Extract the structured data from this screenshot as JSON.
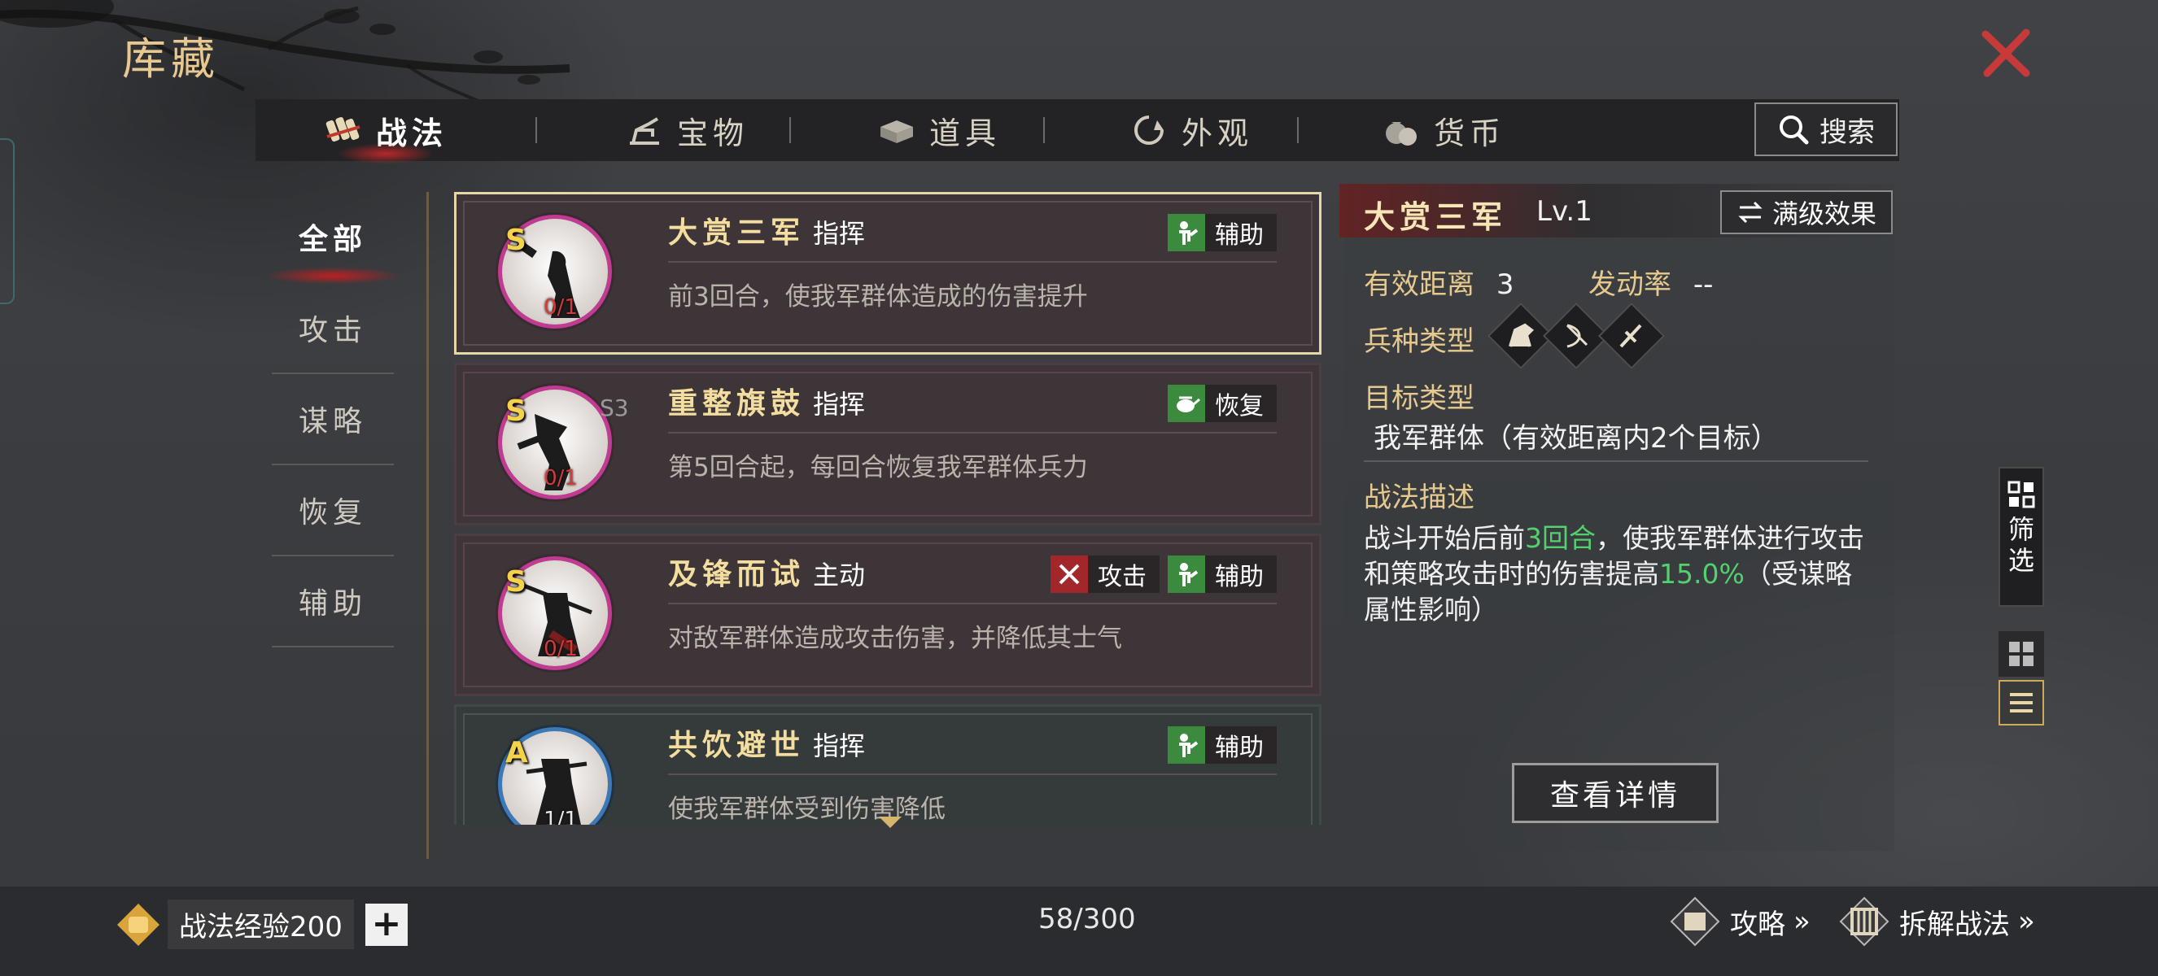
{
  "header": {
    "title": "库藏"
  },
  "tabs": [
    {
      "label": "战法",
      "icon": "scroll-bundle-icon",
      "active": true
    },
    {
      "label": "宝物",
      "icon": "treasure-icon",
      "active": false
    },
    {
      "label": "道具",
      "icon": "item-box-icon",
      "active": false
    },
    {
      "label": "外观",
      "icon": "appearance-icon",
      "active": false
    },
    {
      "label": "货币",
      "icon": "money-bag-icon",
      "active": false
    }
  ],
  "search": {
    "label": "搜索"
  },
  "categories": [
    {
      "label": "全部",
      "active": true
    },
    {
      "label": "攻击",
      "active": false
    },
    {
      "label": "谋略",
      "active": false
    },
    {
      "label": "恢复",
      "active": false
    },
    {
      "label": "辅助",
      "active": false
    }
  ],
  "skills": [
    {
      "grade": "S",
      "name": "大赏三军",
      "kind": "指挥",
      "count": "0/1",
      "season": "",
      "desc": "前3回合，使我军群体造成的伤害提升",
      "tags": [
        {
          "label": "辅助",
          "color": "#3b8a3e"
        }
      ],
      "selected": true
    },
    {
      "grade": "S",
      "name": "重整旗鼓",
      "kind": "指挥",
      "count": "0/1",
      "season": "S3",
      "desc": "第5回合起，每回合恢复我军群体兵力",
      "tags": [
        {
          "label": "恢复",
          "color": "#3b8a3e"
        }
      ],
      "selected": false
    },
    {
      "grade": "S",
      "name": "及锋而试",
      "kind": "主动",
      "count": "0/1",
      "season": "",
      "desc": "对敌军群体造成攻击伤害，并降低其士气",
      "tags": [
        {
          "label": "攻击",
          "color": "#a3262a"
        },
        {
          "label": "辅助",
          "color": "#3b8a3e"
        }
      ],
      "selected": false
    },
    {
      "grade": "A",
      "name": "共饮避世",
      "kind": "指挥",
      "count": "1/1",
      "season": "",
      "desc": "使我军群体受到伤害降低",
      "tags": [
        {
          "label": "辅助",
          "color": "#3b8a3e"
        }
      ],
      "selected": false
    }
  ],
  "detail": {
    "name": "大赏三军",
    "level": "Lv.1",
    "max_level_label": "满级效果",
    "range_label": "有效距离",
    "range_value": "3",
    "rate_label": "发动率",
    "rate_value": "--",
    "troop_label": "兵种类型",
    "troop_types": [
      "cavalry-icon",
      "archer-icon",
      "spearman-icon"
    ],
    "target_label": "目标类型",
    "target_value": "我军群体（有效距离内2个目标）",
    "desc_title": "战法描述",
    "desc_parts": {
      "p1": "战斗开始后前",
      "h1": "3回合",
      "p2": "，使我军群体进行攻击和策略攻击时的伤害提高",
      "h2": "15.0%",
      "p3": "（受谋略属性影响）"
    },
    "view_button": "查看详情",
    "highlight_color": "#53d16e"
  },
  "side": {
    "filter_label": [
      "筛",
      "选"
    ]
  },
  "bottom": {
    "exp_label": "战法经验",
    "exp_value": "200",
    "plus": "+",
    "counter": "58/300",
    "strategy_label": "攻略",
    "dismantle_label": "拆解战法"
  },
  "colors": {
    "accent_gold": "#e6c98e",
    "close_red": "#c73a3a",
    "bg": "#3b3d41"
  }
}
